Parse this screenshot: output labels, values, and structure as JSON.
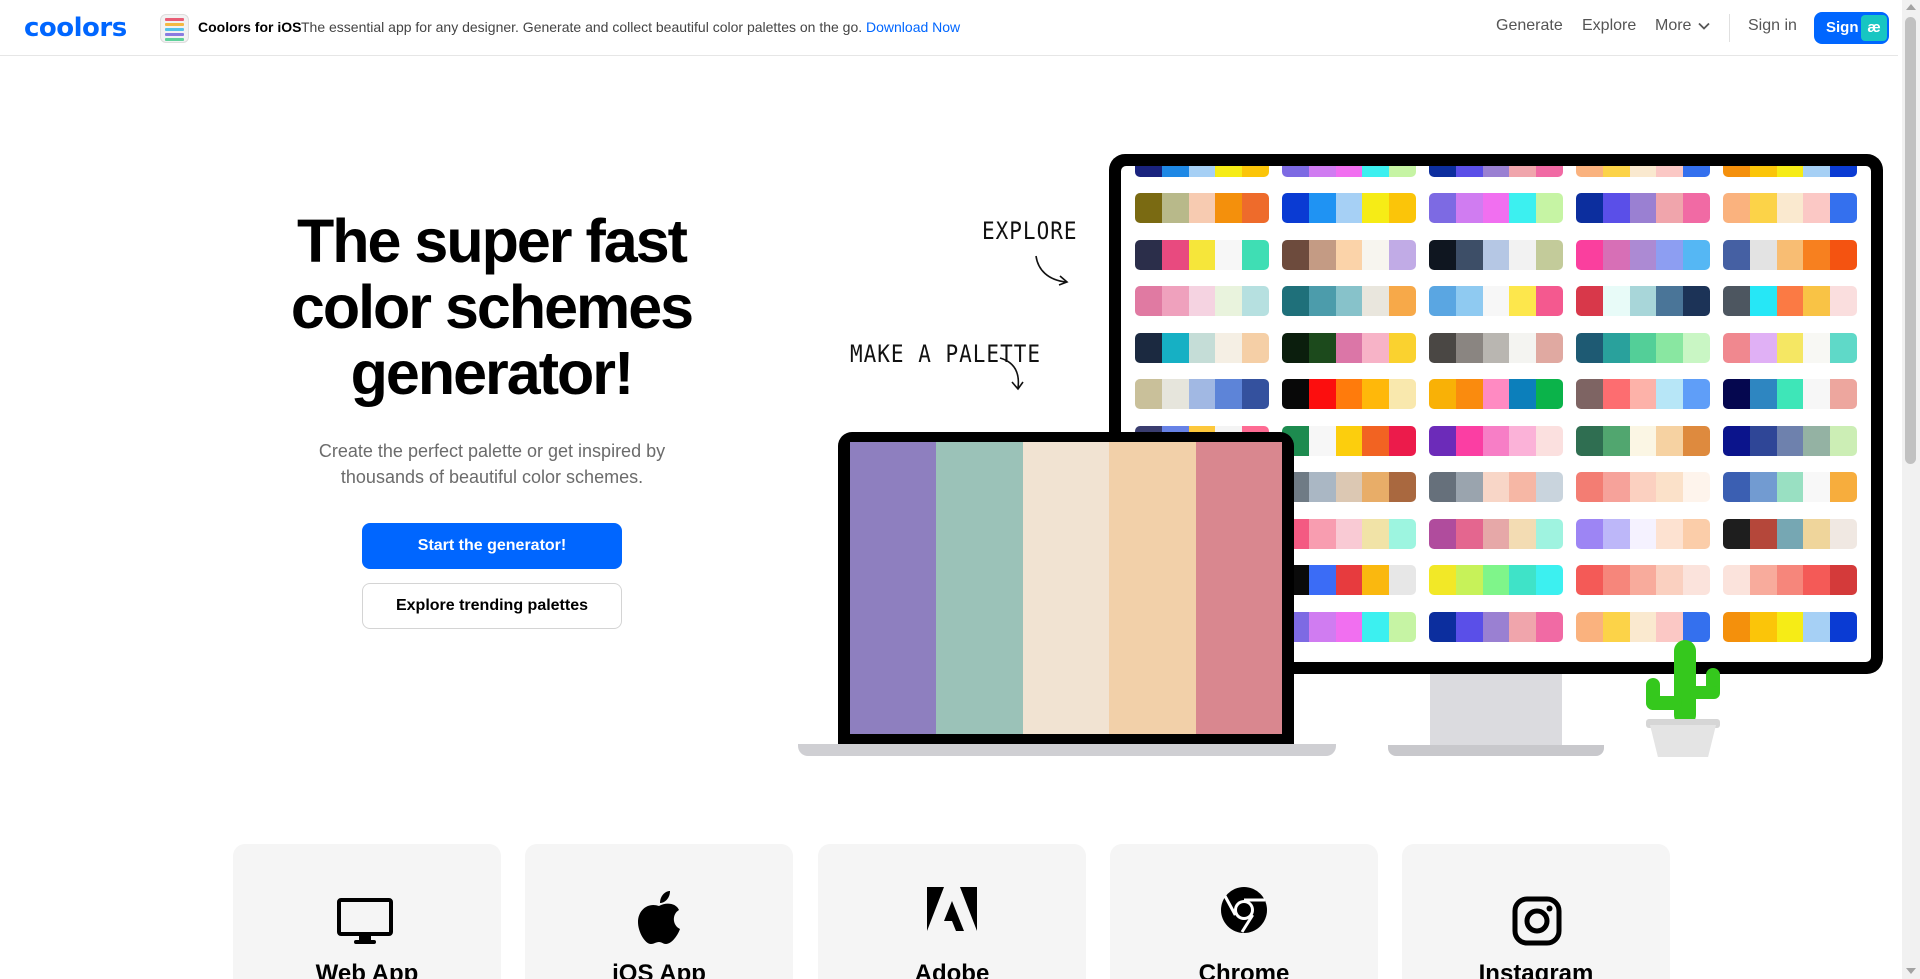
{
  "header": {
    "logo": "coolors",
    "promo": {
      "title": "Coolors for iOS",
      "text": "The essential app for any designer. Generate and collect beautiful color palettes on the go.",
      "link": "Download Now"
    },
    "nav": {
      "generate": "Generate",
      "explore": "Explore",
      "more": "More",
      "sign_in": "Sign in",
      "sign_up": "Sign up"
    }
  },
  "hero": {
    "title_lines": [
      "The super fast",
      "color schemes",
      "generator!"
    ],
    "subtitle_lines": [
      "Create the perfect palette or get inspired by",
      "thousands of beautiful color schemes."
    ],
    "primary_button": "Start the generator!",
    "secondary_button": "Explore trending palettes"
  },
  "illustration": {
    "label_explore": "EXPLORE",
    "label_make_palette": "MAKE A PALETTE",
    "laptop_palette": [
      "#8e7fbf",
      "#9bc2b8",
      "#f1e3d2",
      "#f2d0a9",
      "#d9878f"
    ],
    "monitor_palettes": [
      [
        [
          "#7a6a12",
          "#b8b98a",
          "#f7cbb1",
          "#f4900c",
          "#ee6b2b"
        ],
        [
          "#0a3bd3",
          "#1f93f3",
          "#a6d0f5",
          "#f6ec16",
          "#fbc509"
        ],
        [
          "#7d6ae3",
          "#d07cf1",
          "#f16ff0",
          "#3cf0f0",
          "#c6f4a4"
        ],
        [
          "#0c2e9e",
          "#5a4fe8",
          "#9a80d2",
          "#f0a5ac",
          "#f16aa4"
        ],
        [
          "#fab27e",
          "#fcd348",
          "#fae9cf",
          "#fbc8c5",
          "#3470ee"
        ]
      ],
      [
        [
          "#2b2e4a",
          "#e84a7f",
          "#f6e63a",
          "#f7f7f7",
          "#3fdeb4"
        ],
        [
          "#6d4b3d",
          "#c49b84",
          "#fbd3a9",
          "#f7f5ef",
          "#c1abe6"
        ],
        [
          "#0f1620",
          "#3d4e67",
          "#b5c7e4",
          "#f2f2f2",
          "#c3cb9a"
        ],
        [
          "#fa3f9e",
          "#d76fb6",
          "#ac8ad3",
          "#8d9ef2",
          "#55b7f4"
        ],
        [
          "#4560a3",
          "#e3e3e3",
          "#f8bd73",
          "#f7801f",
          "#f45311"
        ]
      ],
      [
        [
          "#e07aa2",
          "#efa1bd",
          "#f5d3e1",
          "#e9f3dd",
          "#b6e0e0"
        ],
        [
          "#1f707a",
          "#4c9cab",
          "#87c2ca",
          "#e9e6dd",
          "#f7a949"
        ],
        [
          "#5aa6e2",
          "#8fcaf1",
          "#f7f7f7",
          "#fde74c",
          "#f4598f"
        ],
        [
          "#d8384a",
          "#e8fbf8",
          "#a8d6d9",
          "#4a7598",
          "#1c3357"
        ],
        [
          "#4d5660",
          "#26e7f6",
          "#fb7a44",
          "#f9c345",
          "#fadede"
        ]
      ],
      [
        [
          "#1b2940",
          "#16b0c4",
          "#c5ddd7",
          "#f5efe4",
          "#f5cfa6"
        ],
        [
          "#0b1e0d",
          "#1c4a1c",
          "#db76a7",
          "#f7b3c7",
          "#fad22f"
        ],
        [
          "#4a4744",
          "#8a8581",
          "#b9b6b1",
          "#f4f4f1",
          "#e0a9a1"
        ],
        [
          "#1e5a73",
          "#29a19c",
          "#53cf98",
          "#89e7a1",
          "#c9f6c4"
        ],
        [
          "#f0888f",
          "#e0b0f5",
          "#f5e763",
          "#f8f8f4",
          "#5fd9c8"
        ]
      ],
      [
        [
          "#c9c09a",
          "#e6e5dc",
          "#a1b8e3",
          "#5d84d8",
          "#34519e"
        ],
        [
          "#080808",
          "#fc0e0e",
          "#ff7b0c",
          "#ffb80a",
          "#f9e8ad"
        ],
        [
          "#f9b106",
          "#fa8b0e",
          "#ff8ac2",
          "#0c7fbb",
          "#0bb34a"
        ],
        [
          "#7e6463",
          "#fd6d70",
          "#fdb2a9",
          "#b7e6f7",
          "#5f9ef8"
        ],
        [
          "#05074f",
          "#2e86c1",
          "#3ee6b8",
          "#f7f7f7",
          "#eda69e"
        ]
      ],
      [
        [
          "#3a3d6f",
          "#6782e6",
          "#fdc83b",
          "#f4f4f4",
          "#fe6b93"
        ],
        [
          "#1d8b4f",
          "#f7f7f7",
          "#fcce0d",
          "#f26322",
          "#ec1b4b"
        ],
        [
          "#6c2bb9",
          "#fb3ea3",
          "#f77ec6",
          "#fbb2d8",
          "#fbe0df"
        ],
        [
          "#2f6e51",
          "#51a66f",
          "#fbf6e4",
          "#f6d2a2",
          "#de8a3e"
        ],
        [
          "#0b148c",
          "#2f4697",
          "#6e81ad",
          "#94b2a3",
          "#cceeb5"
        ]
      ],
      [
        [
          "#6f6e84",
          "#a89fc6",
          "#b6c3de",
          "#d8f5f2",
          "#dbc894"
        ],
        [
          "#6f7b85",
          "#aab7c4",
          "#dcc8b3",
          "#e8ad68",
          "#a9683f"
        ],
        [
          "#66707b",
          "#9aa4ae",
          "#f8d6c7",
          "#f6b7a5",
          "#c9d4dd"
        ],
        [
          "#f37d73",
          "#f6a29a",
          "#fbd0c0",
          "#fbe1c9",
          "#fef4ec"
        ],
        [
          "#3b5fb2",
          "#729bd1",
          "#99e0c2",
          "#f8f8f8",
          "#f7ad3d"
        ]
      ],
      [
        [
          "#1e1c36",
          "#e78d94",
          "#d3b2bb",
          "#b6dadc",
          "#98f3ea"
        ],
        [
          "#f45a82",
          "#f89db0",
          "#f9cad4",
          "#f1e3a7",
          "#9df5e0"
        ],
        [
          "#b04c9d",
          "#e4668f",
          "#e6a8a8",
          "#f3dcb3",
          "#9ff3e0"
        ],
        [
          "#9d85f4",
          "#bdb7f9",
          "#f5f2ff",
          "#fde2d1",
          "#fbcda9"
        ],
        [
          "#1e1e1e",
          "#b5473a",
          "#76a7b3",
          "#efd59b",
          "#f0e8e2"
        ]
      ],
      [
        [
          "#0a3bd3",
          "#f69c12",
          "#fdc94f",
          "#3d8b2a",
          "#0c4a14"
        ],
        [
          "#0a0a0a",
          "#3b6cf6",
          "#e73b3e",
          "#fab80f",
          "#e7e7e7"
        ],
        [
          "#f2e827",
          "#c7f259",
          "#7ff58a",
          "#3fe3c8",
          "#3cf0f0"
        ],
        [
          "#f45a57",
          "#f6867b",
          "#f8ab9c",
          "#fad0c0",
          "#fbe3dc"
        ],
        [
          "#fbe3dc",
          "#f8ab9c",
          "#f6867b",
          "#f45a57",
          "#d43a3a"
        ]
      ],
      [
        [
          "#1a237e",
          "#1e88e5",
          "#a6d0f5",
          "#f6ec16",
          "#fbc509"
        ],
        [
          "#7d6ae3",
          "#d07cf1",
          "#f16ff0",
          "#3cf0f0",
          "#c6f4a4"
        ],
        [
          "#0c2e9e",
          "#5a4fe8",
          "#9a80d2",
          "#f0a5ac",
          "#f16aa4"
        ],
        [
          "#fab27e",
          "#fcd348",
          "#fae9cf",
          "#fbc8c5",
          "#3470ee"
        ],
        [
          "#f4900c",
          "#fbc509",
          "#f6ec16",
          "#a6d0f5",
          "#0a3bd3"
        ]
      ]
    ]
  },
  "features": [
    {
      "label": "Web App",
      "icon": "monitor-icon"
    },
    {
      "label": "iOS App",
      "icon": "apple-icon"
    },
    {
      "label": "Adobe",
      "icon": "adobe-icon"
    },
    {
      "label": "Chrome",
      "icon": "chrome-icon"
    },
    {
      "label": "Instagram",
      "icon": "instagram-icon"
    }
  ],
  "colors": {
    "brand_blue": "#0066ff",
    "promo_link": "#0066ff",
    "cactus_green": "#35c81d"
  }
}
